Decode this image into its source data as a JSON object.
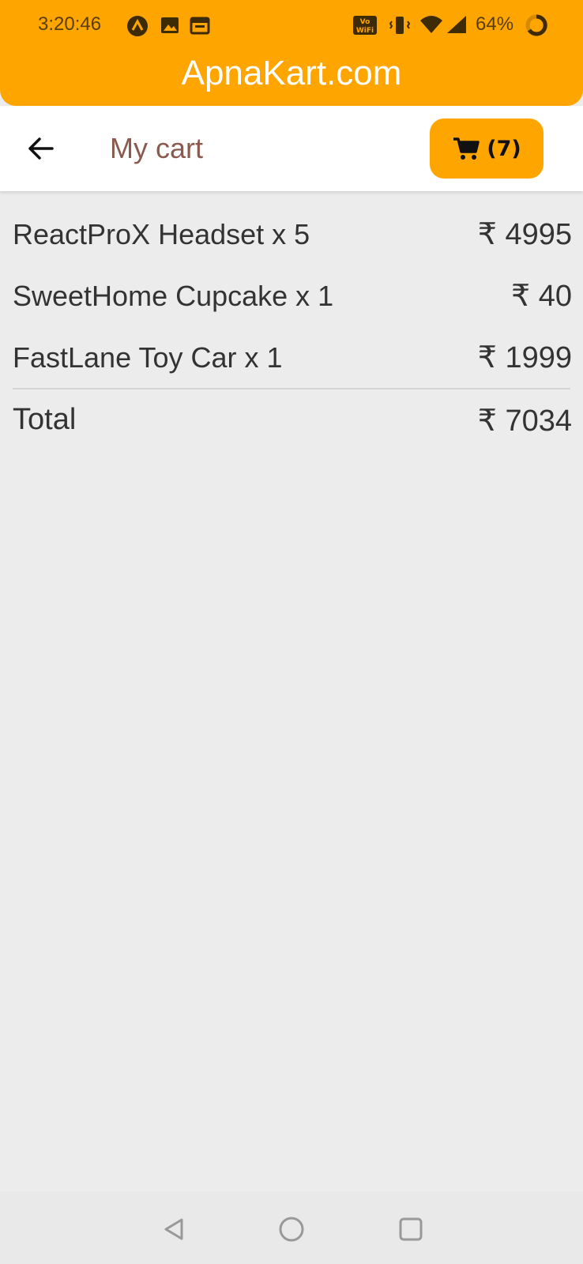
{
  "status_bar": {
    "time": "3:20:46",
    "battery": "64%",
    "wifi_badge": "Vo WiFi"
  },
  "app": {
    "title": "ApnaKart.com",
    "accent_color": "#ffa500"
  },
  "toolbar": {
    "title": "My cart",
    "cart_count": "(7)"
  },
  "cart": {
    "items": [
      {
        "name": "ReactProX Headset x 5",
        "price": "₹ 4995"
      },
      {
        "name": "SweetHome Cupcake x 1",
        "price": "₹ 40"
      },
      {
        "name": "FastLane Toy Car x 1",
        "price": "₹ 1999"
      }
    ],
    "total_label": "Total",
    "total_amount": "₹ 7034"
  },
  "icons": {
    "back": "arrow-left-icon",
    "cart": "shopping-cart-icon",
    "nav_back": "triangle-back-icon",
    "nav_home": "circle-home-icon",
    "nav_recents": "square-recents-icon"
  }
}
